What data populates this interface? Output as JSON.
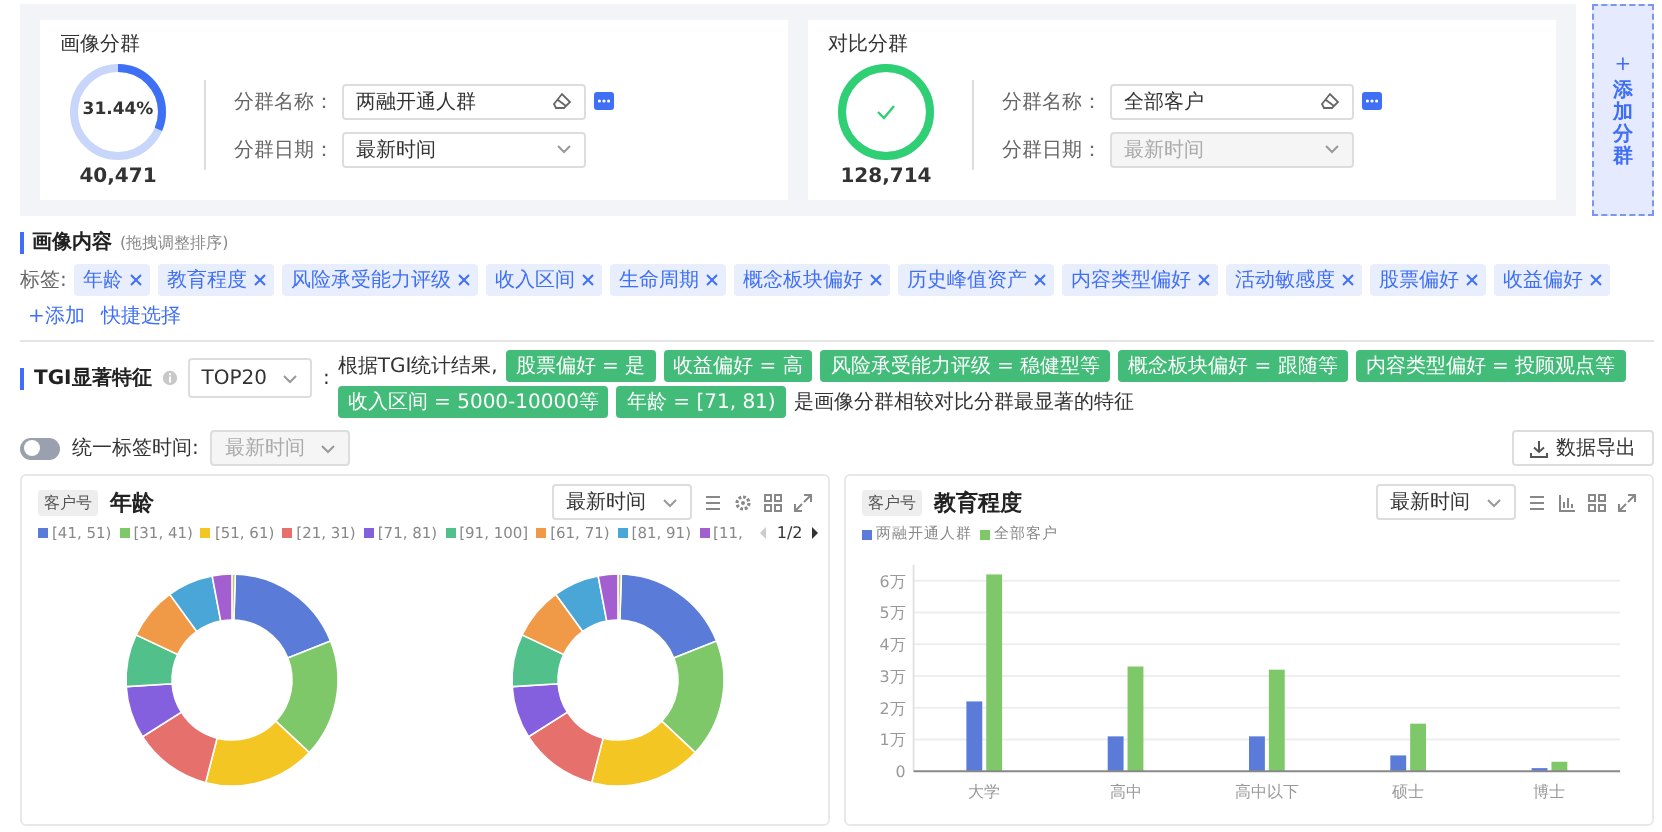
{
  "cohorts": [
    {
      "kind": "portrait",
      "title": "画像分群",
      "ring_label": "31.44%",
      "level": 0.3144,
      "count": "40,471",
      "name_label": "分群名称：",
      "name_value": "两融开通人群",
      "date_label": "分群日期：",
      "date_value": "最新时间",
      "disabled": false
    },
    {
      "kind": "compare",
      "title": "对比分群",
      "level": 1,
      "count": "128,714",
      "name_label": "分群名称：",
      "name_value": "全部客户",
      "date_label": "分群日期：",
      "date_value": "最新时间",
      "disabled": true
    }
  ],
  "add_cohort": {
    "icon": "+",
    "label": "添加分群"
  },
  "profile": {
    "title": "画像内容",
    "hint": "(拖拽调整排序)",
    "tags_label": "标签:",
    "tags": [
      "年龄",
      "教育程度",
      "风险承受能力评级",
      "收入区间",
      "生命周期",
      "概念板块偏好",
      "历史峰值资产",
      "内容类型偏好",
      "活动敏感度",
      "股票偏好",
      "收益偏好"
    ],
    "add_link": "+添加",
    "quick_link": "快捷选择"
  },
  "tgi": {
    "title": "TGI显著特征",
    "top_select": "TOP20",
    "colon": ":",
    "intro": "根据TGI统计结果,",
    "features": [
      "股票偏好 = 是",
      "收益偏好 = 高",
      "风险承受能力评级 = 稳健型等",
      "概念板块偏好 = 跟随等",
      "内容类型偏好 = 投顾观点等",
      "收入区间 = 5000-10000等",
      "年龄 = [71, 81)"
    ],
    "outro": "是画像分群相较对比分群最显著的特征"
  },
  "unify": {
    "on": false,
    "label": "统一标签时间:",
    "select": "最新时间",
    "export_button": "数据导出"
  },
  "panels": [
    {
      "kind": "donut",
      "badge": "客户号",
      "title": "年龄",
      "select": "最新时间",
      "legend": [
        {
          "label": "[41, 51)",
          "color": "#5b7bd8"
        },
        {
          "label": "[31, 41)",
          "color": "#7ec86a"
        },
        {
          "label": "[51, 61)",
          "color": "#f3c623"
        },
        {
          "label": "[21, 31)",
          "color": "#e5706c"
        },
        {
          "label": "[71, 81)",
          "color": "#8460de"
        },
        {
          "label": "[91, 100]",
          "color": "#52c08a"
        },
        {
          "label": "[61, 71)",
          "color": "#f09a48"
        },
        {
          "label": "[81, 91)",
          "color": "#4aa6d6"
        },
        {
          "label": "[11,",
          "color": "#a35fd0"
        }
      ],
      "page": "1/2"
    },
    {
      "kind": "bar",
      "badge": "客户号",
      "title": "教育程度",
      "select": "最新时间",
      "chart_data": {
        "type": "bar",
        "categories": [
          "大学",
          "高中",
          "高中以下",
          "硕士",
          "博士"
        ],
        "series": [
          {
            "name": "两融开通人群",
            "color": "#5b7bd8",
            "values": [
              2.2,
              1.1,
              1.1,
              0.5,
              0.1
            ]
          },
          {
            "name": "全部客户",
            "color": "#7ec86a",
            "values": [
              6.2,
              3.3,
              3.2,
              1.5,
              0.3
            ]
          }
        ],
        "ylim": [
          0,
          6.5
        ],
        "grid": true,
        "yticks": [
          {
            "value": 0,
            "label": "0"
          },
          {
            "value": 1,
            "label": "1万"
          },
          {
            "value": 2,
            "label": "2万"
          },
          {
            "value": 3,
            "label": "3万"
          },
          {
            "value": 4,
            "label": "4万"
          },
          {
            "value": 5,
            "label": "5万"
          },
          {
            "value": 6,
            "label": "6万"
          }
        ]
      }
    }
  ]
}
